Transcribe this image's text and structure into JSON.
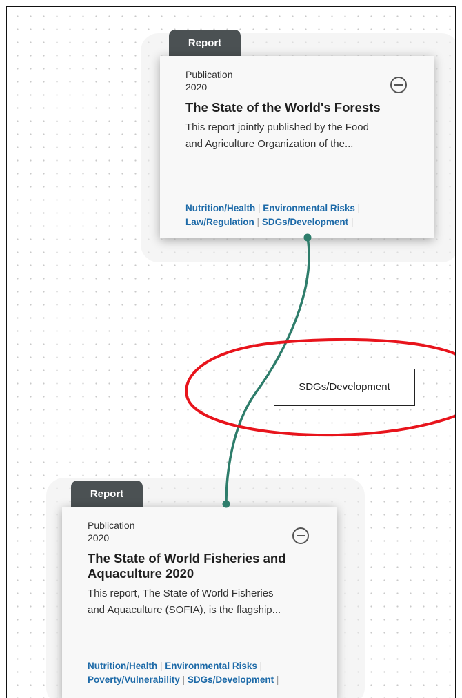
{
  "cards": [
    {
      "tab_label": "Report",
      "type": "Publication",
      "year": "2020",
      "title": "The State of the World's Forests",
      "description_line1": "This report jointly published by the Food",
      "description_line2": "and Agriculture Organization of the...",
      "tags": [
        "Nutrition/Health",
        "Environmental Risks",
        "Law/Regulation",
        "SDGs/Development"
      ]
    },
    {
      "tab_label": "Report",
      "type": "Publication",
      "year": "2020",
      "title_line1": "The State of World Fisheries and",
      "title_line2": "Aquaculture 2020",
      "description_line1": "This report, The State of World Fisheries",
      "description_line2": "and Aquaculture (SOFIA), is the flagship...",
      "tags": [
        "Nutrition/Health",
        "Environmental Risks",
        "Poverty/Vulnerability",
        "SDGs/Development"
      ]
    }
  ],
  "separator": "|",
  "edge": {
    "label": "SDGs/Development"
  },
  "colors": {
    "edge": "#2e7d6b",
    "highlight": "#e8141c",
    "tab": "#4b5153",
    "tag": "#1d6aa8"
  }
}
